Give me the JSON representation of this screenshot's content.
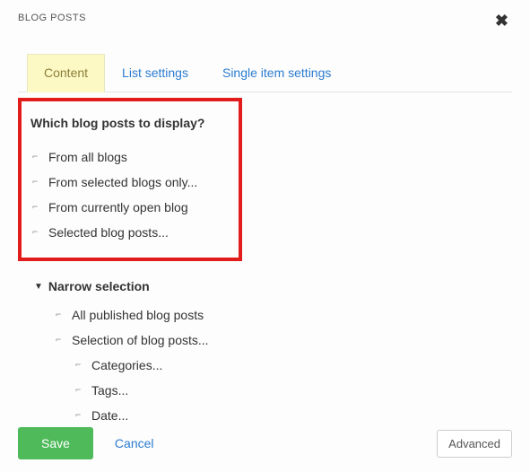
{
  "header": {
    "title": "BLOG POSTS"
  },
  "tabs": [
    {
      "label": "Content"
    },
    {
      "label": "List settings"
    },
    {
      "label": "Single item settings"
    }
  ],
  "section": {
    "heading": "Which blog posts to display?",
    "options": [
      "From all blogs",
      "From selected blogs only...",
      "From currently open blog",
      "Selected blog posts..."
    ]
  },
  "narrow": {
    "heading": "Narrow selection",
    "options": [
      "All published blog posts",
      "Selection of blog posts..."
    ],
    "criteria": [
      "Categories...",
      "Tags...",
      "Date..."
    ]
  },
  "footer": {
    "save": "Save",
    "cancel": "Cancel",
    "advanced": "Advanced"
  }
}
